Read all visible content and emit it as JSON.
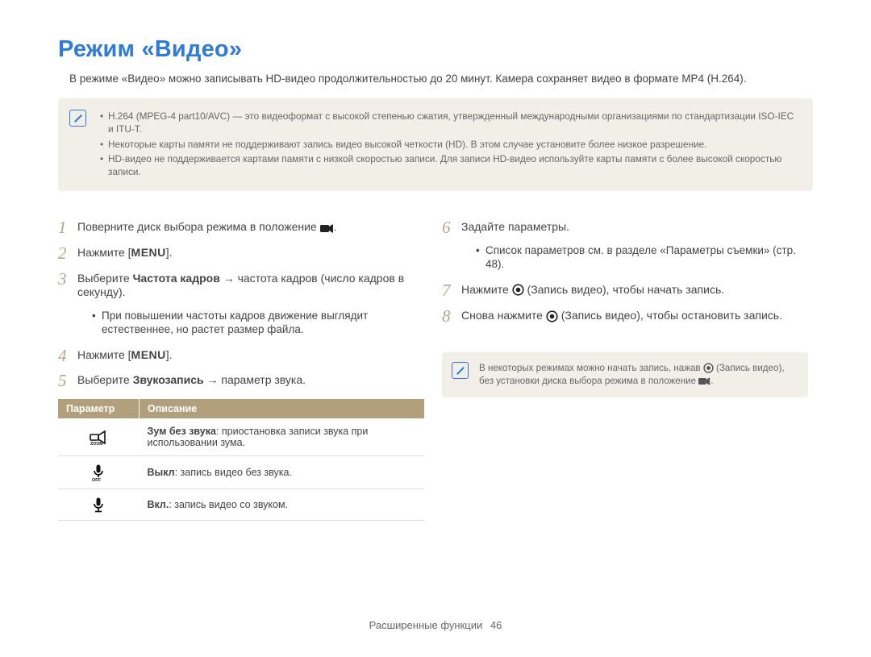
{
  "title": "Режим «Видео»",
  "intro": "В режиме «Видео» можно записывать HD-видео продолжительностью до 20 минут. Камера сохраняет видео в формате MP4 (H.264).",
  "note1": {
    "items": [
      "H.264 (MPEG-4 part10/AVC) — это видеоформат с высокой степенью сжатия, утвержденный международными организациями по стандартизации ISO-IEC и ITU-T.",
      "Некоторые карты памяти не поддерживают запись видео высокой четкости (HD). В этом случае установите более низкое разрешение.",
      "HD-видео не поддерживается картами памяти с низкой скоростью записи. Для записи HD-видео используйте карты памяти с более высокой скоростью записи."
    ]
  },
  "left": {
    "step1_pre": "Поверните диск выбора режима в положение ",
    "step1_post": ".",
    "step2_pre": "Нажмите [",
    "step2_menu": "MENU",
    "step2_post": "].",
    "step3_pre": "Выберите ",
    "step3_bold": "Частота кадров",
    "step3_post": " → частота кадров (число кадров в секунду).",
    "step3_sub": "При повышении частоты кадров движение выглядит естественнее, но растет размер файла.",
    "step4_pre": "Нажмите [",
    "step4_menu": "MENU",
    "step4_post": "].",
    "step5_pre": "Выберите ",
    "step5_bold": "Звукозапись",
    "step5_post": " → параметр звука."
  },
  "table": {
    "h1": "Параметр",
    "h2": "Описание",
    "rows": [
      {
        "label_bold": "Зум без звука",
        "label_rest": ": приостановка записи звука при использовании зума."
      },
      {
        "label_bold": "Выкл",
        "label_rest": ": запись видео без звука."
      },
      {
        "label_bold": "Вкл.",
        "label_rest": ": запись видео со звуком."
      }
    ]
  },
  "right": {
    "step6": "Задайте параметры.",
    "step6_sub": "Список параметров см. в разделе «Параметры съемки» (стр. 48).",
    "step7_pre": "Нажмите ",
    "step7_mid": " (Запись видео), чтобы начать запись.",
    "step8_pre": "Снова нажмите ",
    "step8_mid": " (Запись видео), чтобы остановить запись."
  },
  "note2": {
    "pre": "В некоторых режимах можно начать запись, нажав ",
    "mid": " (Запись видео), без установки диска выбора режима в положение ",
    "post": "."
  },
  "footer": {
    "section": "Расширенные функции",
    "page": "46"
  }
}
